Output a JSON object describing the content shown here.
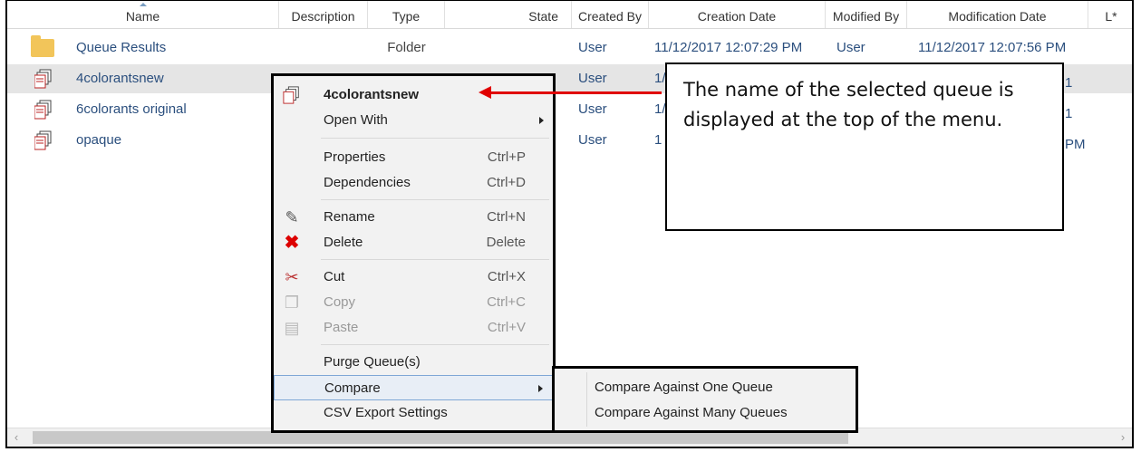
{
  "columns": [
    "Name",
    "Description",
    "Type",
    "State",
    "Created By",
    "Creation Date",
    "Modified By",
    "Modification Date",
    "L*"
  ],
  "rows": [
    {
      "icon": "folder-icon",
      "name": "Queue Results",
      "type": "Folder",
      "created_by": "User",
      "creation_date": "11/12/2017 12:07:29 PM",
      "modified_by": "User",
      "modification_date": "11/12/2017 12:07:56 PM"
    },
    {
      "icon": "queue-icon",
      "name": "4colorantsnew",
      "created_by": "User",
      "creation_date_partial": "1/",
      "modification_date_partial": "1"
    },
    {
      "icon": "queue-icon",
      "name": "6colorants original",
      "created_by": "User",
      "creation_date_partial": "1/",
      "modification_date_partial": "1"
    },
    {
      "icon": "queue-icon",
      "name": "opaque",
      "created_by": "User",
      "creation_date_partial": "1",
      "modification_date_partial": "PM"
    }
  ],
  "context_menu": {
    "title": "4colorantsnew",
    "open_with": "Open With",
    "properties": {
      "label": "Properties",
      "shortcut": "Ctrl+P"
    },
    "dependencies": {
      "label": "Dependencies",
      "shortcut": "Ctrl+D"
    },
    "rename": {
      "label": "Rename",
      "shortcut": "Ctrl+N"
    },
    "delete": {
      "label": "Delete",
      "shortcut": "Delete"
    },
    "cut": {
      "label": "Cut",
      "shortcut": "Ctrl+X"
    },
    "copy": {
      "label": "Copy",
      "shortcut": "Ctrl+C"
    },
    "paste": {
      "label": "Paste",
      "shortcut": "Ctrl+V"
    },
    "purge": "Purge Queue(s)",
    "compare": "Compare",
    "csv": "CSV Export Settings"
  },
  "submenu": {
    "one": "Compare Against One Queue",
    "many": "Compare Against Many Queues"
  },
  "callout": {
    "text": "The name of the selected queue is displayed at the top of the menu."
  },
  "colors": {
    "link": "#2b4f7e",
    "arrow": "#e00000",
    "menu_bg": "#f2f2f2",
    "selected_row": "#e5e5e5"
  }
}
